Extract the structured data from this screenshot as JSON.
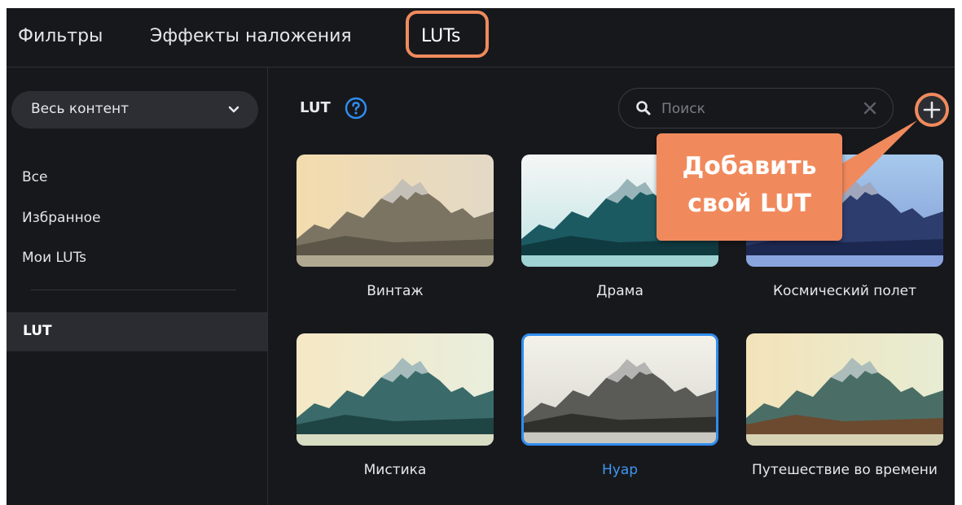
{
  "tabs": [
    {
      "label": "Фильтры"
    },
    {
      "label": "Эффекты наложения"
    },
    {
      "label": "LUTs"
    }
  ],
  "active_tab": "LUTs",
  "sidebar": {
    "dropdown": {
      "selected": "Весь контент"
    },
    "items": [
      {
        "label": "Все"
      },
      {
        "label": "Избранное"
      },
      {
        "label": "Мои LUTs"
      }
    ],
    "section_item": {
      "label": "LUT"
    }
  },
  "main": {
    "title": "LUT",
    "search": {
      "placeholder": "Поиск",
      "value": ""
    },
    "cards": [
      {
        "label": "Винтаж",
        "selected": false
      },
      {
        "label": "Драма",
        "selected": false
      },
      {
        "label": "Космический полет",
        "selected": false
      },
      {
        "label": "Мистика",
        "selected": false
      },
      {
        "label": "Нуар",
        "selected": true
      },
      {
        "label": "Путешествие во времени",
        "selected": false
      }
    ]
  },
  "callout": {
    "line1": "Добавить",
    "line2": "свой LUT"
  },
  "icons": {
    "help": "help-icon",
    "search": "search-icon",
    "clear": "close-icon",
    "add": "plus-icon",
    "dropdown": "chevron-down-icon"
  },
  "colors": {
    "background": "#17181c",
    "accent_highlight": "#f08a5d",
    "selection_blue": "#2f8df0"
  }
}
